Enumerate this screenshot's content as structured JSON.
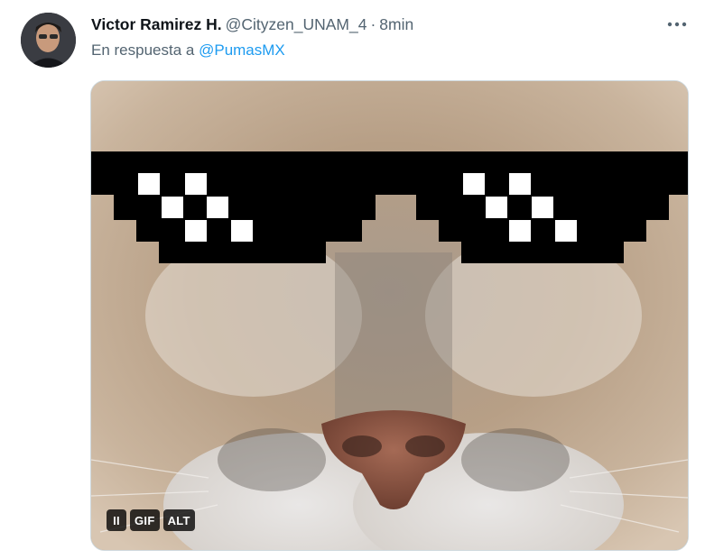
{
  "tweet": {
    "author": {
      "display_name": "Victor Ramirez H.",
      "handle": "@Cityzen_UNAM_4",
      "avatar_icon": "user-avatar"
    },
    "separator": "·",
    "timestamp": "8min",
    "reply_prefix": "En respuesta a",
    "reply_to": "@PumasMX",
    "more_icon": "more-horizontal-icon",
    "media": {
      "kind": "gif",
      "image_description_icon": "puma-with-pixel-sunglasses",
      "controls": {
        "pause_label": "II",
        "gif_label": "GIF",
        "alt_label": "ALT"
      }
    }
  },
  "colors": {
    "text_primary": "#0f1419",
    "text_secondary": "#536471",
    "link": "#1d9bf0",
    "background": "#ffffff"
  }
}
